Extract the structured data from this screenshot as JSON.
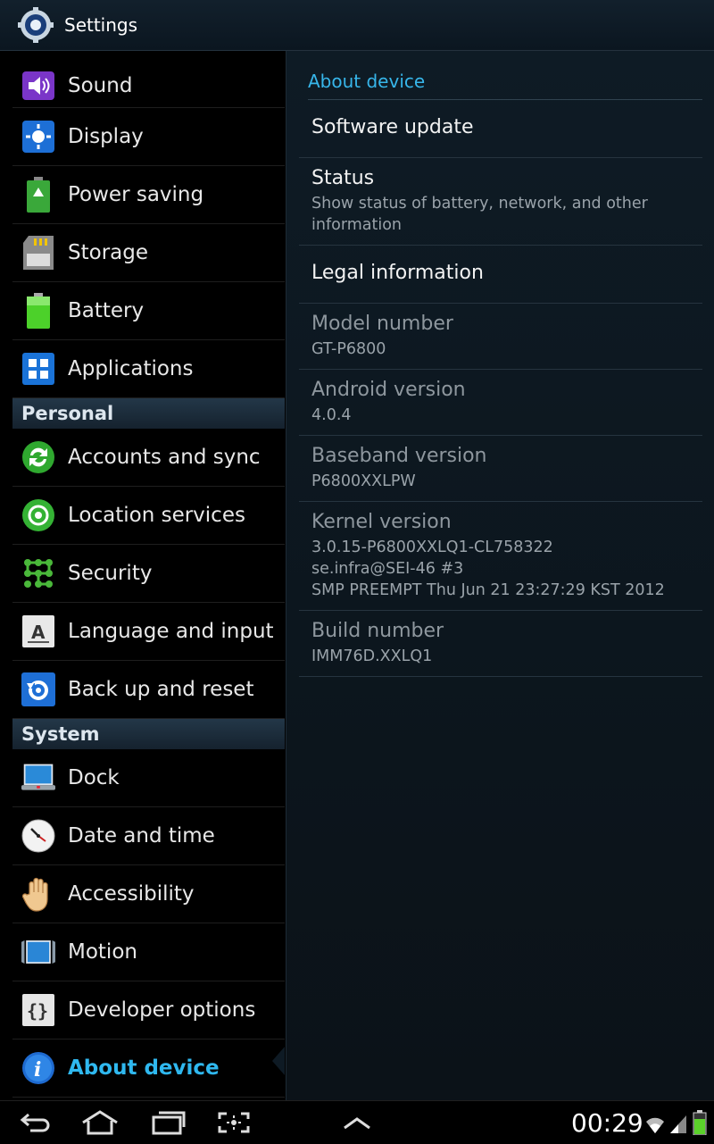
{
  "titlebar": {
    "title": "Settings",
    "icon": "gear-icon"
  },
  "sidebar": {
    "top_items": [
      {
        "label": "Sound",
        "icon": "sound-icon"
      },
      {
        "label": "Display",
        "icon": "display-icon"
      },
      {
        "label": "Power saving",
        "icon": "power-saving-icon"
      },
      {
        "label": "Storage",
        "icon": "storage-icon"
      },
      {
        "label": "Battery",
        "icon": "battery-icon"
      },
      {
        "label": "Applications",
        "icon": "applications-icon"
      }
    ],
    "personal_header": "Personal",
    "personal_items": [
      {
        "label": "Accounts and sync",
        "icon": "sync-icon"
      },
      {
        "label": "Location services",
        "icon": "location-icon"
      },
      {
        "label": "Security",
        "icon": "security-icon"
      },
      {
        "label": "Language and input",
        "icon": "language-icon"
      },
      {
        "label": "Back up and reset",
        "icon": "backup-icon"
      }
    ],
    "system_header": "System",
    "system_items": [
      {
        "label": "Dock",
        "icon": "dock-icon"
      },
      {
        "label": "Date and time",
        "icon": "clock-icon"
      },
      {
        "label": "Accessibility",
        "icon": "hand-icon"
      },
      {
        "label": "Motion",
        "icon": "motion-icon"
      },
      {
        "label": "Developer options",
        "icon": "braces-icon"
      },
      {
        "label": "About device",
        "icon": "info-icon",
        "active": true
      }
    ]
  },
  "panel": {
    "header": "About device",
    "rows": [
      {
        "title": "Software update",
        "subtitle": "",
        "interactive": true
      },
      {
        "title": "Status",
        "subtitle": "Show status of battery, network, and other information",
        "interactive": true
      },
      {
        "title": "Legal information",
        "subtitle": "",
        "interactive": true
      },
      {
        "title": "Model number",
        "subtitle": "GT-P6800",
        "interactive": false
      },
      {
        "title": "Android version",
        "subtitle": "4.0.4",
        "interactive": false
      },
      {
        "title": "Baseband version",
        "subtitle": "P6800XXLPW",
        "interactive": false
      },
      {
        "title": "Kernel version",
        "subtitle": "3.0.15-P6800XXLQ1-CL758322\nse.infra@SEI-46 #3\nSMP PREEMPT Thu Jun 21 23:27:29 KST 2012",
        "interactive": false
      },
      {
        "title": "Build number",
        "subtitle": "IMM76D.XXLQ1",
        "interactive": false
      }
    ]
  },
  "navbar": {
    "clock": "00:29",
    "buttons": [
      "back-icon",
      "home-icon",
      "recent-apps-icon",
      "screenshot-icon",
      "up-arrow-icon"
    ],
    "status_icons": [
      "wifi-icon",
      "signal-icon",
      "battery-status-icon"
    ]
  },
  "colors": {
    "accent": "#2fb8ef",
    "panel_bg": "#0e1b25"
  }
}
